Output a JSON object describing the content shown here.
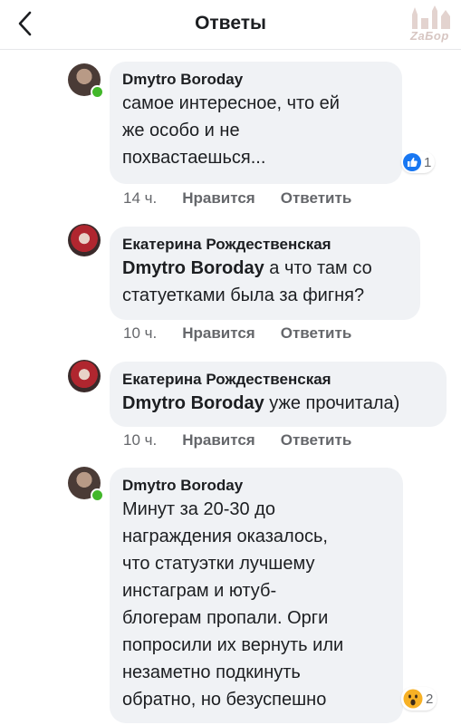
{
  "header": {
    "title": "Ответы",
    "watermark": "ZaБор"
  },
  "colors": {
    "bubble": "#f0f2f5",
    "online": "#42b72a",
    "like": "#1877f2",
    "meta": "#65676b"
  },
  "comments": [
    {
      "author": "Dmytro Boroday",
      "lines": [
        "самое интересное, что ей",
        "же особо и не",
        "похвастаешься..."
      ],
      "reaction": {
        "icon": "like-icon",
        "count": "1"
      },
      "time": "14 ч.",
      "like_label": "Нравится",
      "reply_label": "Ответить"
    },
    {
      "author": "Екатерина Рождественская",
      "mention": "Dmytro Boroday",
      "first_line_rest": " а что там со",
      "lines": [
        "статуетками была за фигня?"
      ],
      "time": "10 ч.",
      "like_label": "Нравится",
      "reply_label": "Ответить"
    },
    {
      "author": "Екатерина Рождественская",
      "mention": "Dmytro Boroday",
      "first_line_rest": " уже прочитала)",
      "time": "10 ч.",
      "like_label": "Нравится",
      "reply_label": "Ответить"
    },
    {
      "author": "Dmytro Boroday",
      "lines": [
        "Минут за 20-30 до",
        "награждения оказалось,",
        "что статуэтки лучшему",
        "инстаграм и ютуб-",
        "блогерам пропали. Орги",
        "попросили их вернуть или",
        "незаметно подкинуть",
        "обратно, но безуспешно"
      ],
      "reaction": {
        "icon": "wow-icon",
        "count": "2"
      }
    }
  ]
}
